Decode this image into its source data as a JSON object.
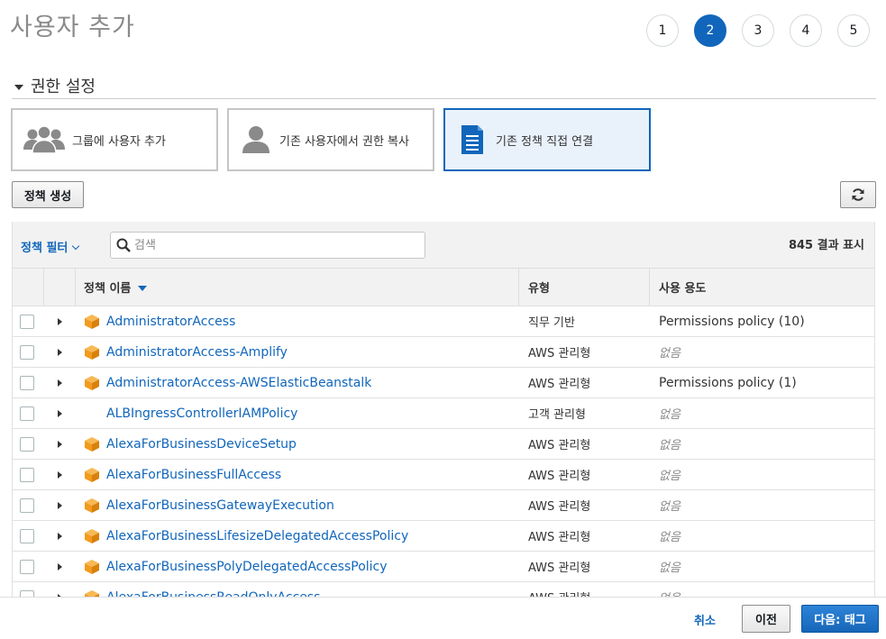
{
  "page_title": "사용자 추가",
  "steps": [
    "1",
    "2",
    "3",
    "4",
    "5"
  ],
  "active_step": "2",
  "section_title": "권한 설정",
  "permission_options": [
    {
      "label": "그룹에 사용자 추가",
      "icon": "users-group-icon",
      "selected": false
    },
    {
      "label": "기존 사용자에서 권한 복사",
      "icon": "user-icon",
      "selected": false
    },
    {
      "label": "기존 정책 직접 연결",
      "icon": "document-icon",
      "selected": true
    }
  ],
  "create_policy_label": "정책 생성",
  "filter": {
    "label": "정책 필터",
    "search_placeholder": "검색",
    "result_count": "845 결과 표시"
  },
  "columns": {
    "name": "정책 이름",
    "type": "유형",
    "usage": "사용 용도"
  },
  "rows": [
    {
      "name": "AdministratorAccess",
      "type": "직무 기반",
      "usage": "Permissions policy (10)",
      "aws_icon": true,
      "usage_empty": false
    },
    {
      "name": "AdministratorAccess-Amplify",
      "type": "AWS 관리형",
      "usage": "없음",
      "aws_icon": true,
      "usage_empty": true
    },
    {
      "name": "AdministratorAccess-AWSElasticBeanstalk",
      "type": "AWS 관리형",
      "usage": "Permissions policy (1)",
      "aws_icon": true,
      "usage_empty": false
    },
    {
      "name": "ALBIngressControllerIAMPolicy",
      "type": "고객 관리형",
      "usage": "없음",
      "aws_icon": false,
      "usage_empty": true
    },
    {
      "name": "AlexaForBusinessDeviceSetup",
      "type": "AWS 관리형",
      "usage": "없음",
      "aws_icon": true,
      "usage_empty": true
    },
    {
      "name": "AlexaForBusinessFullAccess",
      "type": "AWS 관리형",
      "usage": "없음",
      "aws_icon": true,
      "usage_empty": true
    },
    {
      "name": "AlexaForBusinessGatewayExecution",
      "type": "AWS 관리형",
      "usage": "없음",
      "aws_icon": true,
      "usage_empty": true
    },
    {
      "name": "AlexaForBusinessLifesizeDelegatedAccessPolicy",
      "type": "AWS 관리형",
      "usage": "없음",
      "aws_icon": true,
      "usage_empty": true
    },
    {
      "name": "AlexaForBusinessPolyDelegatedAccessPolicy",
      "type": "AWS 관리형",
      "usage": "없음",
      "aws_icon": true,
      "usage_empty": true
    },
    {
      "name": "AlexaForBusinessReadOnlyAccess",
      "type": "AWS 관리형",
      "usage": "없음",
      "aws_icon": true,
      "usage_empty": true
    }
  ],
  "footer": {
    "cancel": "취소",
    "previous": "이전",
    "next": "다음: 태그"
  },
  "colors": {
    "accent": "#1166bb",
    "aws_orange": "#f29b1d",
    "selected_bg": "#e9f2fb"
  }
}
